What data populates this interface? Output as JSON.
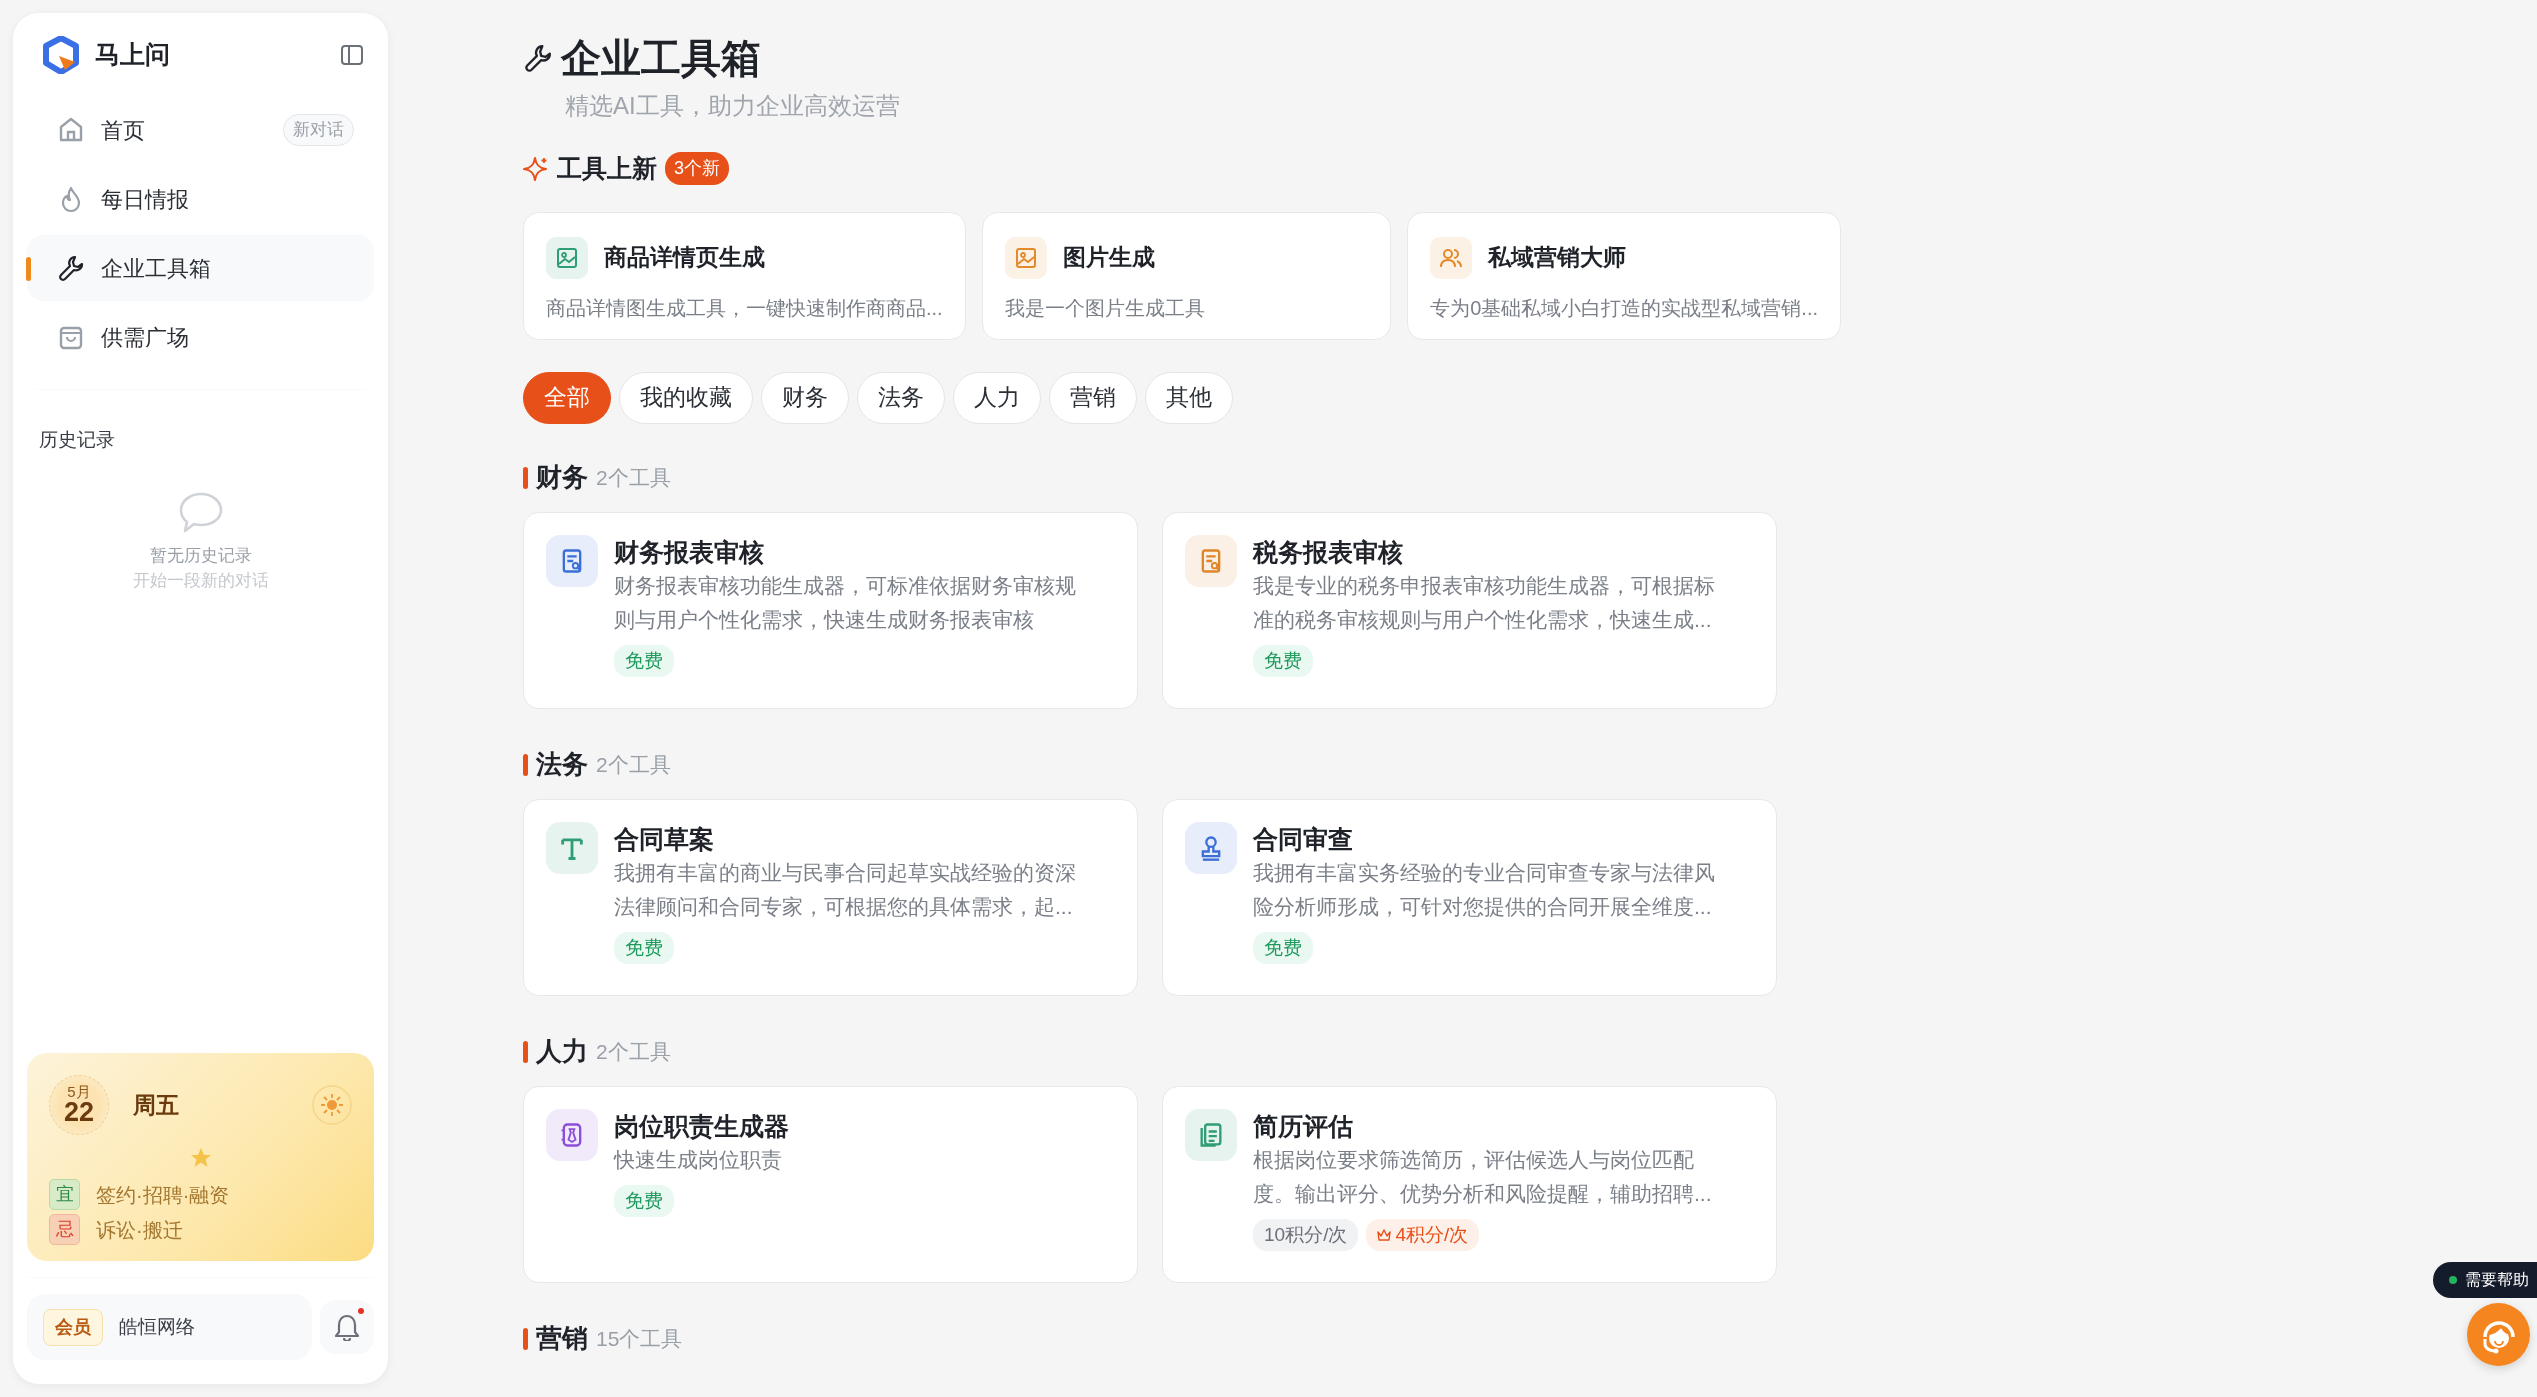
{
  "sidebar": {
    "brand": "马上问",
    "nav": [
      {
        "label": "首页",
        "selected": false,
        "badge": "新对话"
      },
      {
        "label": "每日情报",
        "selected": false
      },
      {
        "label": "企业工具箱",
        "selected": true
      },
      {
        "label": "供需广场",
        "selected": false
      }
    ],
    "history_title": "历史记录",
    "history_empty": {
      "title": "暂无历史记录",
      "hint": "开始一段新的对话"
    },
    "almanac": {
      "month": "5月",
      "day": "22",
      "weekday": "周五",
      "good": {
        "tag": "宜",
        "text": "签约·招聘·融资"
      },
      "bad": {
        "tag": "忌",
        "text": "诉讼·搬迁"
      }
    },
    "account": {
      "badge": "会员",
      "name": "皓恒网络",
      "unread": true
    }
  },
  "header": {
    "title": "企业工具箱",
    "subtitle": "精选AI工具，助力企业高效运营"
  },
  "new_tools": {
    "title": "工具上新",
    "badge": "3个新",
    "items": [
      {
        "name": "商品详情页生成",
        "desc": "商品详情图生成工具，一键快速制作商商品...",
        "color": "#2f9e74"
      },
      {
        "name": "图片生成",
        "desc": "我是一个图片生成工具",
        "color": "#e58a2b"
      },
      {
        "name": "私域营销大师",
        "desc": "专为0基础私域小白打造的实战型私域营销...",
        "color": "#e58a2b"
      }
    ]
  },
  "filters": [
    {
      "label": "全部",
      "selected": true
    },
    {
      "label": "我的收藏",
      "selected": false
    },
    {
      "label": "财务",
      "selected": false
    },
    {
      "label": "法务",
      "selected": false
    },
    {
      "label": "人力",
      "selected": false
    },
    {
      "label": "营销",
      "selected": false
    },
    {
      "label": "其他",
      "selected": false
    }
  ],
  "sections": [
    {
      "title": "财务",
      "count": "2个工具",
      "tools": [
        {
          "name": "财务报表审核",
          "desc": "财务报表审核功能生成器，可标准依据财务审核规则与用户个性化需求，快速生成财务报表审核",
          "color": "#3b6fd8",
          "tags": [
            {
              "text": "免费",
              "kind": "free"
            }
          ]
        },
        {
          "name": "税务报表审核",
          "desc": "我是专业的税务申报表审核功能生成器，可根据标准的税务审核规则与用户个性化需求，快速生成...",
          "color": "#e0862a",
          "tags": [
            {
              "text": "免费",
              "kind": "free"
            }
          ]
        }
      ]
    },
    {
      "title": "法务",
      "count": "2个工具",
      "tools": [
        {
          "name": "合同草案",
          "desc": "我拥有丰富的商业与民事合同起草实战经验的资深法律顾问和合同专家，可根据您的具体需求，起...",
          "color": "#2f9e74",
          "tags": [
            {
              "text": "免费",
              "kind": "free"
            }
          ]
        },
        {
          "name": "合同审查",
          "desc": "我拥有丰富实务经验的专业合同审查专家与法律风险分析师形成，可针对您提供的合同开展全维度...",
          "color": "#3b6fd8",
          "tags": [
            {
              "text": "免费",
              "kind": "free"
            }
          ]
        }
      ]
    },
    {
      "title": "人力",
      "count": "2个工具",
      "tools": [
        {
          "name": "岗位职责生成器",
          "desc": "快速生成岗位职责",
          "color": "#8a4fd8",
          "tags": [
            {
              "text": "免费",
              "kind": "free"
            }
          ]
        },
        {
          "name": "简历评估",
          "desc": "根据岗位要求筛选简历，评估候选人与岗位匹配度。输出评分、优势分析和风险提醒，辅助招聘...",
          "color": "#2f9e74",
          "tags": [
            {
              "text": "10积分/次",
              "kind": "price"
            },
            {
              "text": "4积分/次",
              "kind": "vip_price"
            }
          ]
        }
      ]
    },
    {
      "title": "营销",
      "count": "15个工具"
    }
  ],
  "help": {
    "text": "需要帮助",
    "online": true
  }
}
